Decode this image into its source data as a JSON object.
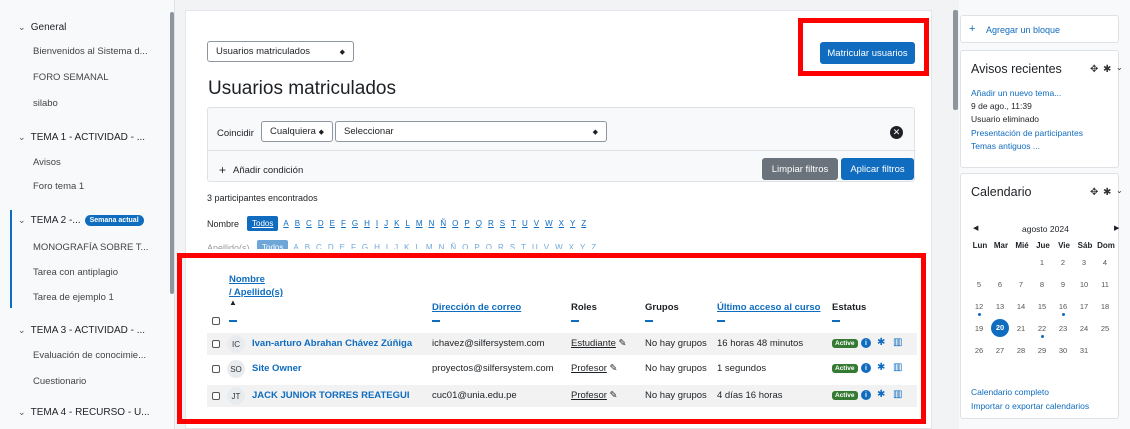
{
  "sidebar": {
    "sections": [
      {
        "label": "General",
        "items": [
          "Bienvenidos al Sistema d...",
          "FORO SEMANAL",
          "silabo"
        ]
      },
      {
        "label": "TEMA 1 - ACTIVIDAD - ...",
        "items": [
          "Avisos",
          "Foro tema 1"
        ]
      },
      {
        "label": "TEMA 2 -...",
        "badge": "Semana actual",
        "items": [
          "MONOGRAFÍA SOBRE T...",
          "Tarea con antiplagio",
          "Tarea de ejemplo 1"
        ]
      },
      {
        "label": "TEMA 3 - ACTIVIDAD - ...",
        "items": [
          "Evaluación de conocimie...",
          "Cuestionario"
        ]
      },
      {
        "label": "TEMA 4 - RECURSO - U...",
        "items": []
      }
    ]
  },
  "main": {
    "page_select": "Usuarios matriculados",
    "enrol_button": "Matricular usuarios",
    "heading": "Usuarios matriculados",
    "filter": {
      "match_label": "Coincidir",
      "match_value": "Cualquiera",
      "type_placeholder": "Seleccionar",
      "add_condition": "Añadir condición",
      "clear_button": "Limpiar filtros",
      "apply_button": "Aplicar filtros"
    },
    "found_text": "3 participantes encontrados",
    "firstname_label": "Nombre",
    "lastname_label": "Apellido(s)",
    "all_label": "Todos",
    "letters": [
      "A",
      "B",
      "C",
      "D",
      "E",
      "F",
      "G",
      "H",
      "I",
      "J",
      "K",
      "L",
      "M",
      "N",
      "Ñ",
      "O",
      "P",
      "Q",
      "R",
      "S",
      "T",
      "U",
      "V",
      "W",
      "X",
      "Y",
      "Z"
    ],
    "table": {
      "headers": {
        "name": "Nombre",
        "surname": "/ Apellido(s)",
        "email": "Dirección de correo",
        "roles": "Roles",
        "groups": "Grupos",
        "last_access": "Último acceso al curso",
        "status": "Estatus"
      },
      "rows": [
        {
          "initials": "IC",
          "name": "Ivan-arturo Abrahan Chávez Zúñiga",
          "email": "ichavez@silfersystem.com",
          "role": "Estudiante",
          "groups": "No hay grupos",
          "last_access": "16 horas 48 minutos",
          "status": "Active"
        },
        {
          "initials": "SO",
          "name": "Site Owner",
          "email": "proyectos@silfersystem.com",
          "role": "Profesor",
          "groups": "No hay grupos",
          "last_access": "1 segundos",
          "status": "Active"
        },
        {
          "initials": "JT",
          "name": "JACK JUNIOR TORRES REATEGUI",
          "email": "cuc01@unia.edu.pe",
          "role": "Profesor",
          "groups": "No hay grupos",
          "last_access": "4 días 16 horas",
          "status": "Active"
        }
      ]
    }
  },
  "right": {
    "add_block": "Agregar un bloque",
    "news": {
      "title": "Avisos recientes",
      "add_topic": "Añadir un nuevo tema...",
      "date": "9 de ago., 11:39",
      "author": "Usuario eliminado",
      "post": "Presentación de participantes",
      "older": "Temas antiguos ..."
    },
    "calendar": {
      "title": "Calendario",
      "month": "agosto 2024",
      "weekdays": [
        "Lun",
        "Mar",
        "Mié",
        "Jue",
        "Vie",
        "Sáb",
        "Dom"
      ],
      "weeks": [
        [
          "",
          "",
          "",
          "1",
          "2",
          "3",
          "4"
        ],
        [
          "5",
          "6",
          "7",
          "8",
          "9",
          "10",
          "11"
        ],
        [
          "12",
          "13",
          "14",
          "15",
          "16",
          "17",
          "18"
        ],
        [
          "19",
          "20",
          "21",
          "22",
          "23",
          "24",
          "25"
        ],
        [
          "26",
          "27",
          "28",
          "29",
          "30",
          "31",
          ""
        ]
      ],
      "today": "20",
      "full_link": "Calendario completo",
      "export_link": "Importar o exportar calendarios"
    }
  },
  "colors": {
    "primary": "#0f6cbf",
    "highlight": "#ff0000",
    "active_badge": "#357a32"
  }
}
